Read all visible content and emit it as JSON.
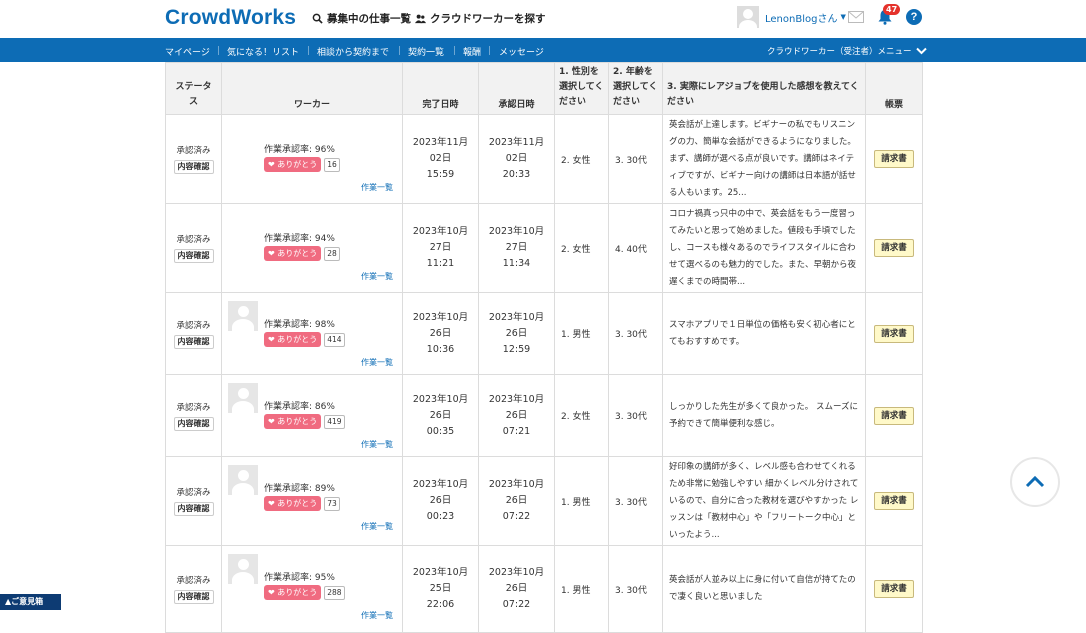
{
  "header": {
    "logo": "CrowdWorks",
    "nav_jobs": "募集中の仕事一覧",
    "nav_workers": "クラウドワーカーを探す",
    "user_name": "LenonBlogさん",
    "notification_count": "47",
    "help": "?"
  },
  "navbar": {
    "items": [
      "マイページ",
      "気になる！リスト",
      "相談から契約まで",
      "契約一覧",
      "報酬",
      "メッセージ"
    ],
    "menu": "クラウドワーカー（受注者）メニュー"
  },
  "table": {
    "headers": {
      "status": "ステータス",
      "worker": "ワーカー",
      "completed": "完了日時",
      "approved": "承認日時",
      "q1": "1. 性別を選択してください",
      "q2": "2. 年齢を選択してください",
      "q3": "3. 実際にレアジョブを使用した感想を教えてください",
      "invoice": "帳票"
    },
    "rows": [
      {
        "status": "承認済み",
        "check": "内容確認",
        "rate": "作業承認率: 96%",
        "thanks": "ありがとう",
        "count": "16",
        "link": "作業一覧",
        "completed": "2023年11月 02日 15:59",
        "approved": "2023年11月 02日 20:33",
        "gender": "2. 女性",
        "age": "3. 30代",
        "comment": "英会話が上達します。ビギナーの私でもリスニングの力、簡単な会話ができるようになりました。まず、講師が選べる点が良いです。講師はネイティブですが、ビギナー向けの講師は日本語が話せる人もいます。25...",
        "invoice": "請求書",
        "avatar": false
      },
      {
        "status": "承認済み",
        "check": "内容確認",
        "rate": "作業承認率: 94%",
        "thanks": "ありがとう",
        "count": "28",
        "link": "作業一覧",
        "completed": "2023年10月 27日 11:21",
        "approved": "2023年10月 27日 11:34",
        "gender": "2. 女性",
        "age": "4. 40代",
        "comment": "コロナ禍真っ只中の中で、英会話をもう一度習ってみたいと思って始めました。値段も手頃でしたし、コースも様々あるのでライフスタイルに合わせて選べるのも魅力的でした。また、早朝から夜遅くまでの時間帯...",
        "invoice": "請求書",
        "avatar": false
      },
      {
        "status": "承認済み",
        "check": "内容確認",
        "rate": "作業承認率: 98%",
        "thanks": "ありがとう",
        "count": "414",
        "link": "作業一覧",
        "completed": "2023年10月 26日 10:36",
        "approved": "2023年10月 26日 12:59",
        "gender": "1. 男性",
        "age": "3. 30代",
        "comment": "スマホアプリで１日単位の価格も安く初心者にとてもおすすめです。",
        "invoice": "請求書",
        "avatar": true
      },
      {
        "status": "承認済み",
        "check": "内容確認",
        "rate": "作業承認率: 86%",
        "thanks": "ありがとう",
        "count": "419",
        "link": "作業一覧",
        "completed": "2023年10月 26日 00:35",
        "approved": "2023年10月 26日 07:21",
        "gender": "2. 女性",
        "age": "3. 30代",
        "comment": "しっかりした先生が多くて良かった。 スムーズに予約できて簡単便利な感じ。",
        "invoice": "請求書",
        "avatar": true
      },
      {
        "status": "承認済み",
        "check": "内容確認",
        "rate": "作業承認率: 89%",
        "thanks": "ありがとう",
        "count": "73",
        "link": "作業一覧",
        "completed": "2023年10月 26日 00:23",
        "approved": "2023年10月 26日 07:22",
        "gender": "1. 男性",
        "age": "3. 30代",
        "comment": "好印象の講師が多く、レベル感も合わせてくれるため非常に勉強しやすい 細かくレベル分けされているので、自分に合った教材を選びやすかった レッスンは「教材中心」や「フリートーク中心」といったよう...",
        "invoice": "請求書",
        "avatar": true
      },
      {
        "status": "承認済み",
        "check": "内容確認",
        "rate": "作業承認率: 95%",
        "thanks": "ありがとう",
        "count": "288",
        "link": "作業一覧",
        "completed": "2023年10月 25日 22:06",
        "approved": "2023年10月 26日 07:22",
        "gender": "1. 男性",
        "age": "3. 30代",
        "comment": "英会話が人並み以上に身に付いて自信が持てたので凄く良いと思いました",
        "invoice": "請求書",
        "avatar": true
      }
    ]
  },
  "feedback": "ご意見箱"
}
